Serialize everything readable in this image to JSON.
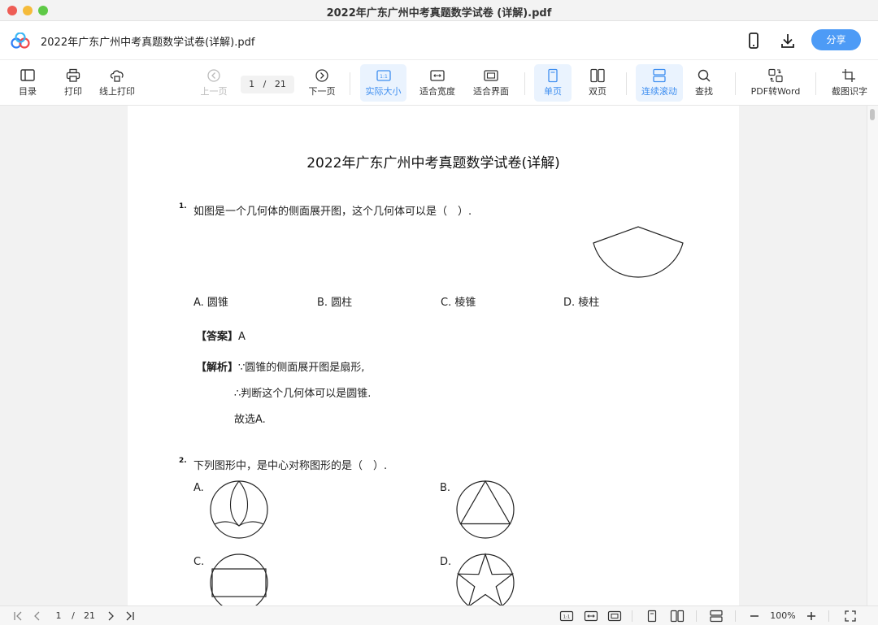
{
  "window": {
    "title": "2022年广东广州中考真题数学试卷 (详解).pdf"
  },
  "header": {
    "filename": "2022年广东广州中考真题数学试卷(详解).pdf",
    "share_label": "分享"
  },
  "toolbar": {
    "toc": "目录",
    "print": "打印",
    "online_print": "线上打印",
    "prev_page": "上一页",
    "page_current": "1",
    "page_sep": "/",
    "page_total": "21",
    "next_page": "下一页",
    "actual_size": "实际大小",
    "fit_width": "适合宽度",
    "fit_window": "适合界面",
    "single_page": "单页",
    "double_page": "双页",
    "continuous_scroll": "连续滚动",
    "find": "查找",
    "pdf_to_word": "PDF转Word",
    "ocr": "截图识字"
  },
  "document": {
    "title": "2022年广东广州中考真题数学试卷(详解)",
    "q1": {
      "num": "1.",
      "text": "如图是一个几何体的侧面展开图，这个几何体可以是（　）.",
      "options": [
        "A. 圆锥",
        "B. 圆柱",
        "C. 棱锥",
        "D. 棱柱"
      ],
      "answer_tag": "【答案】",
      "answer_value": "A",
      "analysis_tag": "【解析】",
      "analysis_lines": [
        "∵圆锥的侧面展开图是扇形,",
        "∴判断这个几何体可以是圆锥.",
        "故选A."
      ]
    },
    "q2": {
      "num": "2.",
      "text": "下列图形中，是中心对称图形的是（　）.",
      "option_labels": [
        "A.",
        "B.",
        "C.",
        "D."
      ]
    }
  },
  "statusbar": {
    "page_current": "1",
    "page_sep": "/",
    "page_total": "21",
    "zoom": "100%"
  },
  "colors": {
    "accent": "#4d9bf6",
    "active_bg": "#eaf3fe",
    "active_text": "#3e8ef0"
  }
}
